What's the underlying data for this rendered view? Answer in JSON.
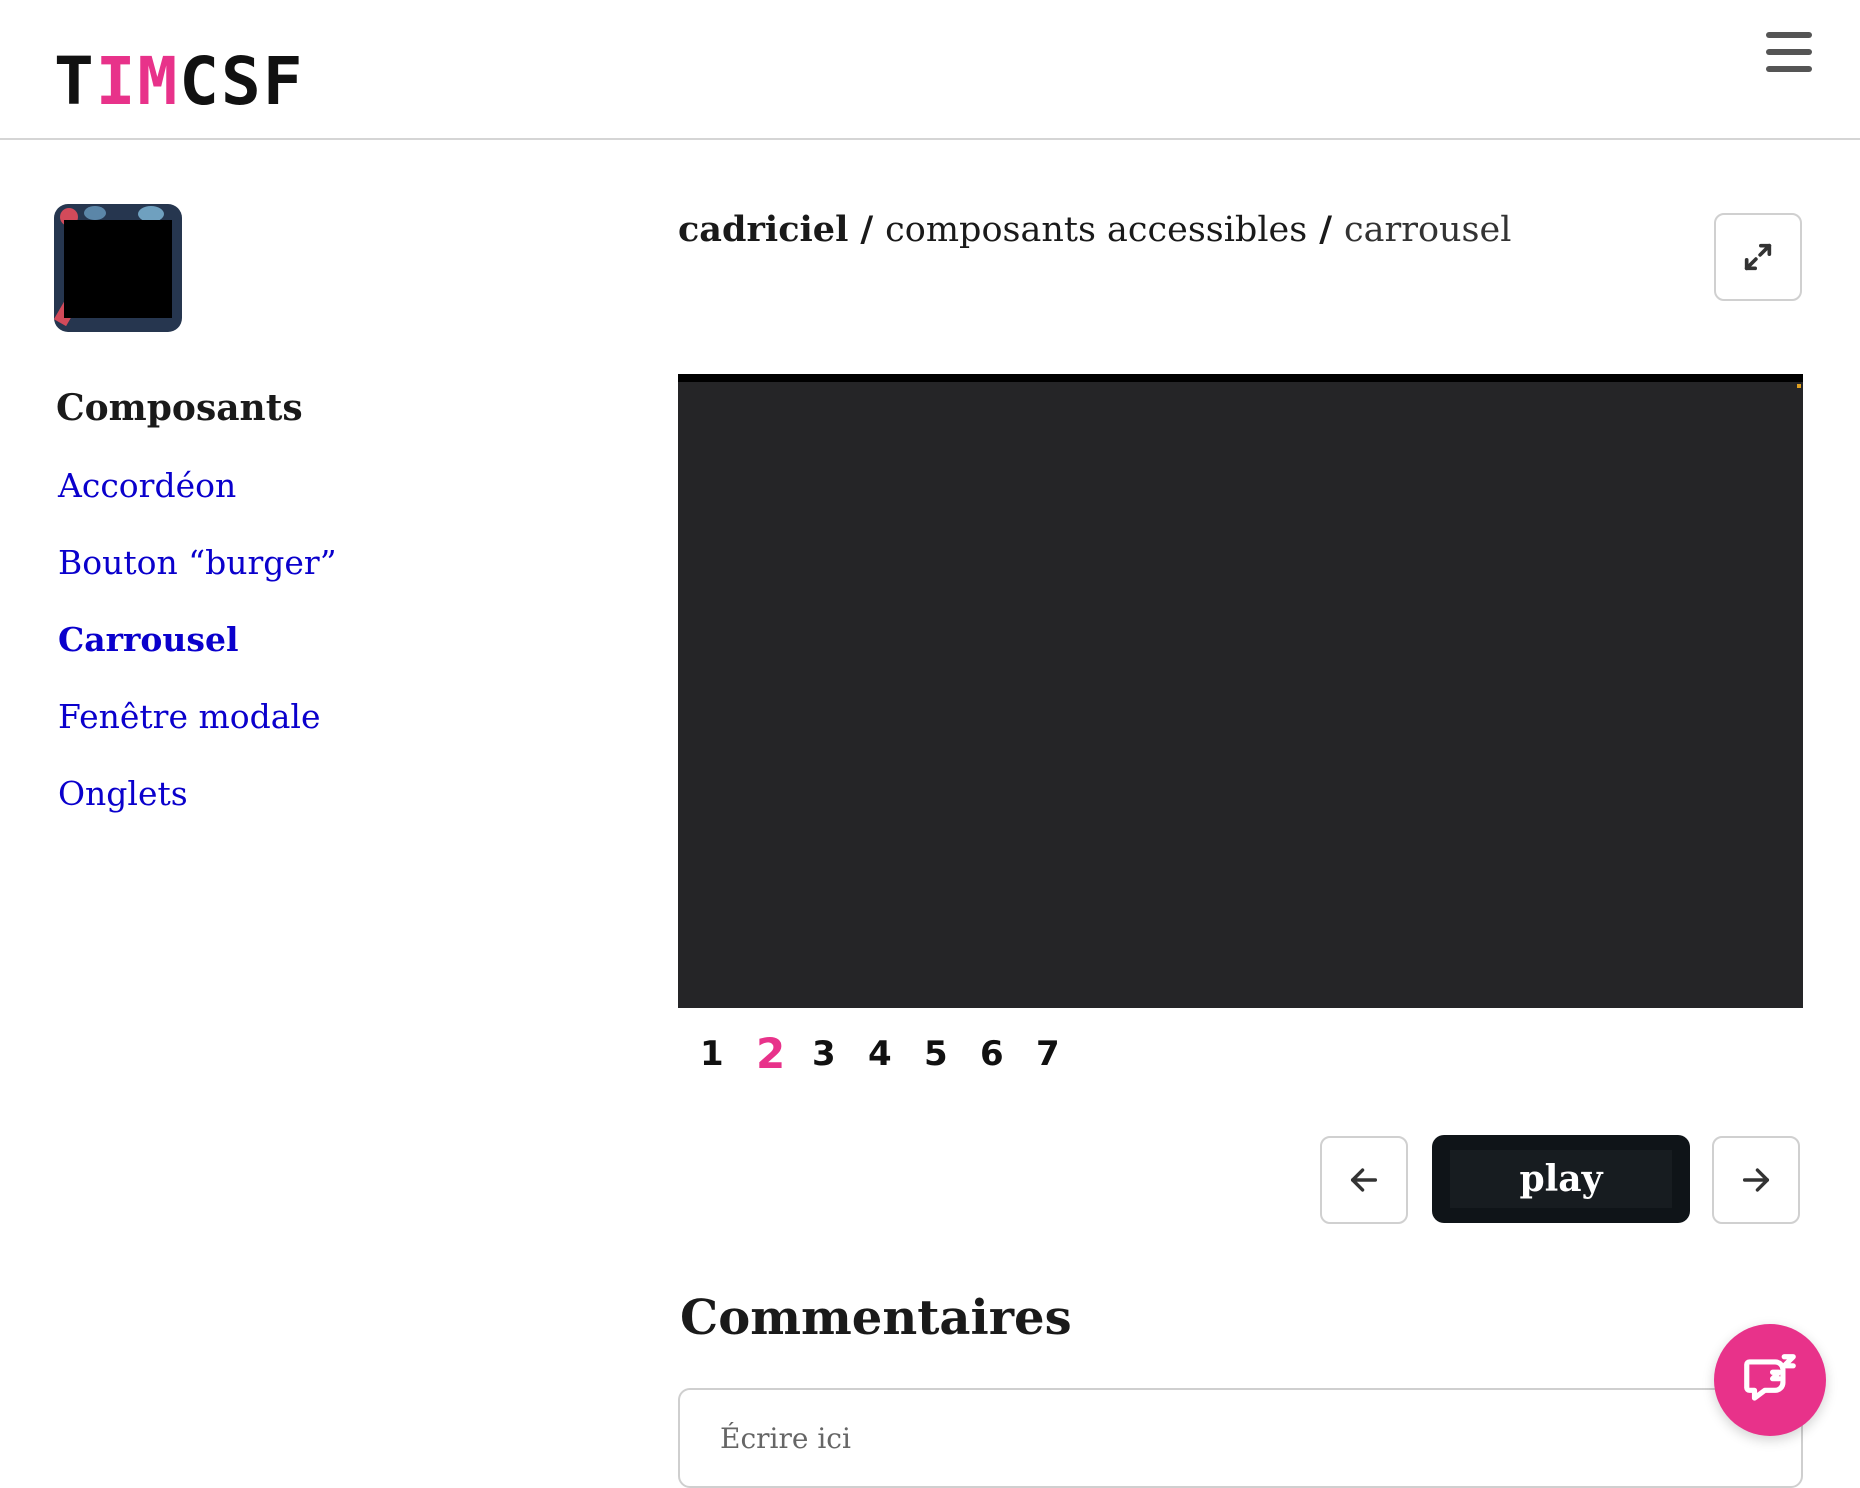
{
  "header": {
    "logo_prefix": "T",
    "logo_accent": "IM",
    "logo_suffix": "CSF",
    "menu_icon": "burger-menu-icon"
  },
  "sidebar": {
    "avatar_icon": "avatar-image",
    "title": "Composants",
    "items": [
      {
        "label": "Accordéon",
        "active": false
      },
      {
        "label": "Bouton “burger”",
        "active": false
      },
      {
        "label": "Carrousel",
        "active": true
      },
      {
        "label": "Fenêtre modale",
        "active": false
      },
      {
        "label": "Onglets",
        "active": false
      }
    ]
  },
  "breadcrumb": {
    "level1": "cadriciel",
    "separator": "/",
    "level2": "composants accessibles",
    "current": "carrousel"
  },
  "toolbar": {
    "expand_icon": "expand-icon"
  },
  "carousel": {
    "pages": [
      "1",
      "2",
      "3",
      "4",
      "5",
      "6",
      "7"
    ],
    "current_page": "2",
    "prev_icon": "arrow-left-icon",
    "next_icon": "arrow-right-icon",
    "play_label": "play"
  },
  "comments": {
    "title": "Commentaires",
    "placeholder": "Écrire ici",
    "chat_icon": "chat-bubble-icon"
  },
  "colors": {
    "accent": "#e8328a",
    "link": "#0a00cc",
    "carousel_bg": "#252527"
  }
}
